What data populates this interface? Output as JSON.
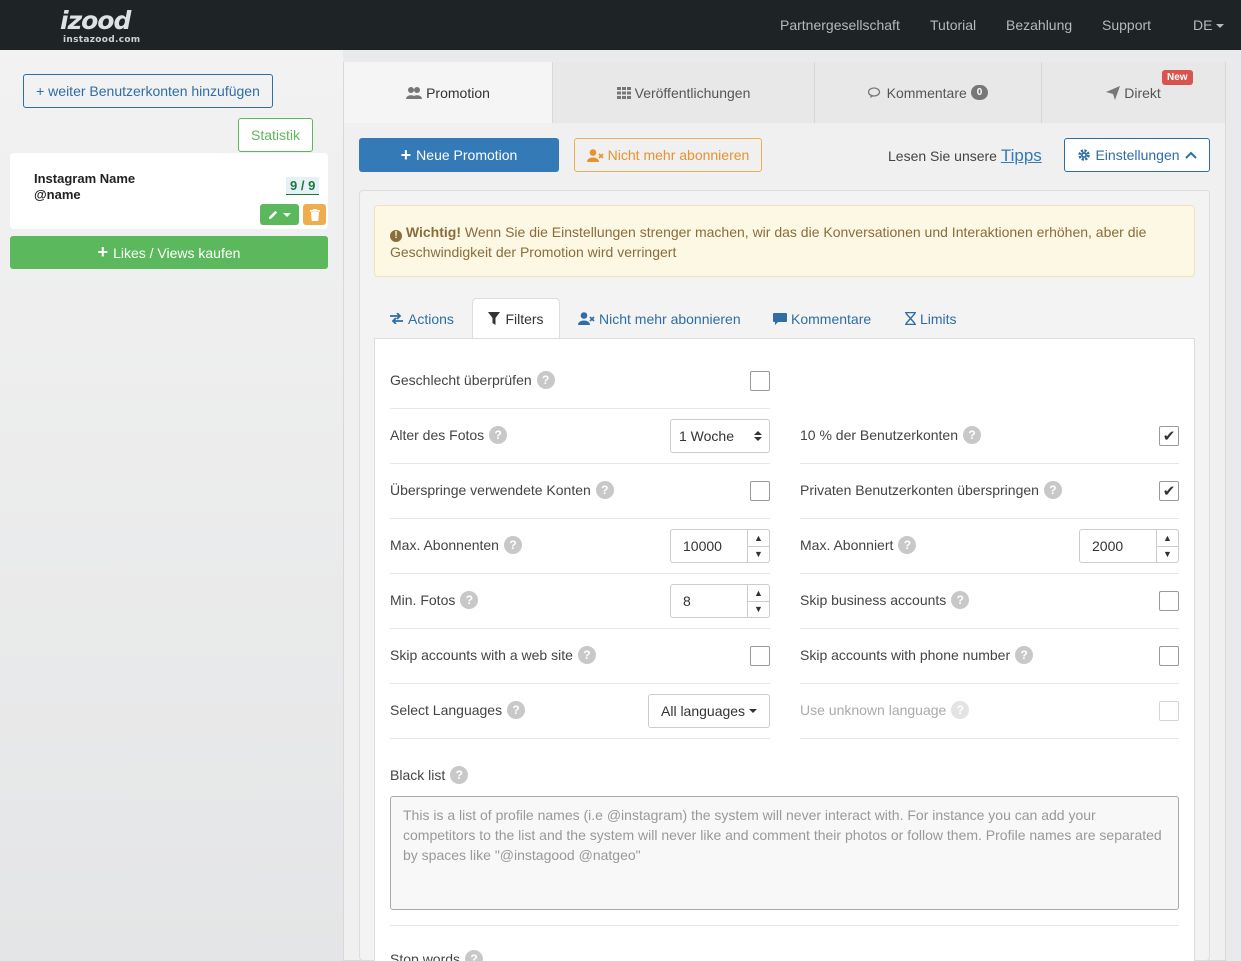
{
  "topbar": {
    "logo": "izood",
    "logo_sub": "instazood.com",
    "nav": [
      "Partnergesellschaft",
      "Tutorial",
      "Bezahlung",
      "Support"
    ],
    "lang": "DE"
  },
  "sidebar": {
    "add_account_label": "+ weiter Benutzerkonten hinzufügen",
    "stats_label": "Statistik",
    "account_name": "Instagram Name",
    "account_handle": "@name",
    "account_count": "9 / 9",
    "buy_label": "Likes / Views kaufen"
  },
  "tabs": {
    "promotion": "Promotion",
    "publications": "Veröffentlichungen",
    "comments": "Kommentare",
    "comments_badge": "0",
    "direct": "Direkt",
    "new_badge": "New"
  },
  "toolbar": {
    "new_promotion": "Neue Promotion",
    "unsubscribe": "Nicht mehr abonnieren",
    "tips_prefix": "Lesen Sie unsere",
    "tips_link": "Tipps",
    "settings": "Einstellungen"
  },
  "alert": {
    "strong": "Wichtig!",
    "text": "Wenn Sie die Einstellungen strenger machen, wir das die Konversationen und Interaktionen erhöhen, aber die Geschwindigkeit der Promotion wird verringert"
  },
  "subtabs": {
    "actions": "Actions",
    "filters": "Filters",
    "unsubscribe": "Nicht mehr abonnieren",
    "comments": "Kommentare",
    "limits": "Limits"
  },
  "filters": {
    "gender_check": "Geschlecht überprüfen",
    "photo_age": "Alter des Fotos",
    "photo_age_value": "1 Woche",
    "ten_percent": "10 % der Benutzerkonten",
    "skip_used": "Überspringe verwendete Konten",
    "skip_private": "Privaten Benutzerkonten überspringen",
    "max_followers": "Max. Abonnenten",
    "max_followers_value": "10000",
    "max_following": "Max. Abonniert",
    "max_following_value": "2000",
    "min_photos": "Min. Fotos",
    "min_photos_value": "8",
    "skip_business": "Skip business accounts",
    "skip_website": "Skip accounts with a web site",
    "skip_phone": "Skip accounts with phone number",
    "select_languages": "Select Languages",
    "languages_value": "All languages",
    "unknown_language": "Use unknown language",
    "black_list": "Black list",
    "black_list_placeholder": "This is a list of profile names (i.e @instagram) the system will never interact with. For instance you can add your competitors to the list and the system will never like and comment their photos or follow them. Profile names are separated by spaces like \"@instagood @natgeo\"",
    "stop_words": "Stop words",
    "help": "?"
  }
}
